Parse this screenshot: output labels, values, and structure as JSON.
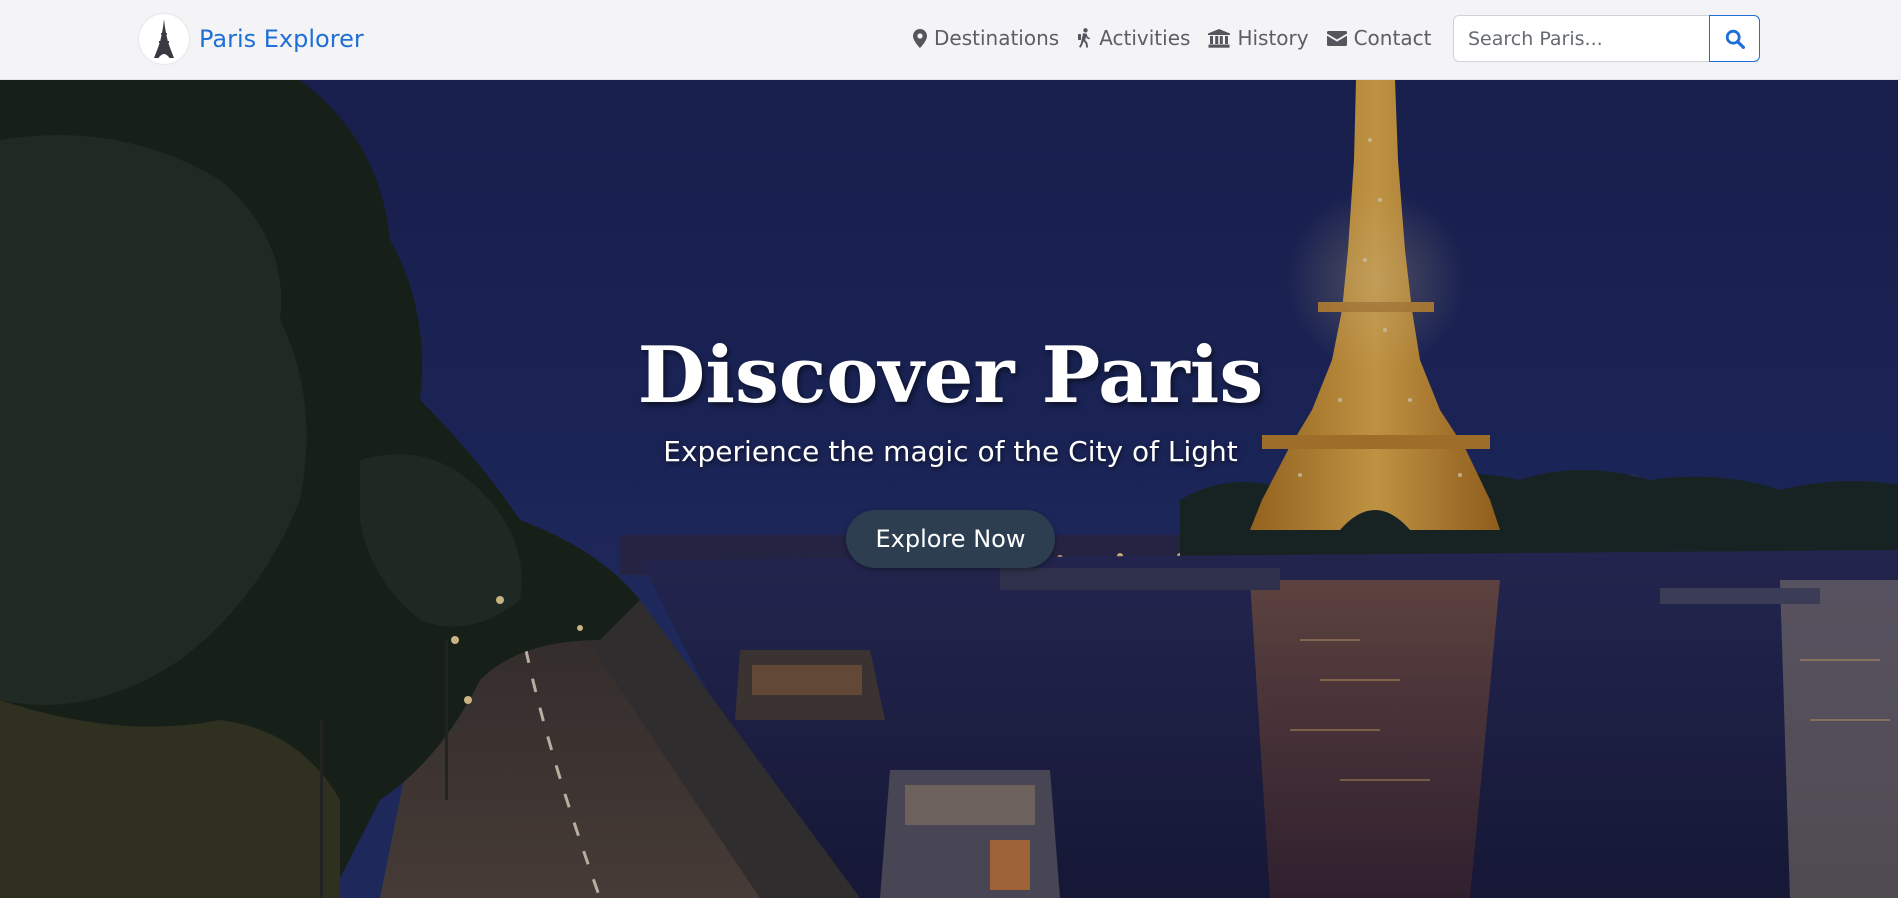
{
  "brand": {
    "name": "Paris Explorer",
    "logo_icon": "eiffel-tower-icon"
  },
  "nav": {
    "items": [
      {
        "label": "Destinations",
        "icon": "map-marker-icon"
      },
      {
        "label": "Activities",
        "icon": "hiking-icon"
      },
      {
        "label": "History",
        "icon": "landmark-icon"
      },
      {
        "label": "Contact",
        "icon": "envelope-icon"
      }
    ]
  },
  "search": {
    "placeholder": "Search Paris...",
    "value": "",
    "button_icon": "search-icon"
  },
  "hero": {
    "title": "Discover Paris",
    "subtitle": "Experience the magic of the City of Light",
    "cta_label": "Explore Now",
    "background_description_icon": "night-seine-eiffel-photo"
  },
  "colors": {
    "brand_blue": "#1f6fd6",
    "navbar_bg": "#f4f4f6",
    "cta_bg": "#2c3e50",
    "nav_text": "#5d5d66"
  }
}
